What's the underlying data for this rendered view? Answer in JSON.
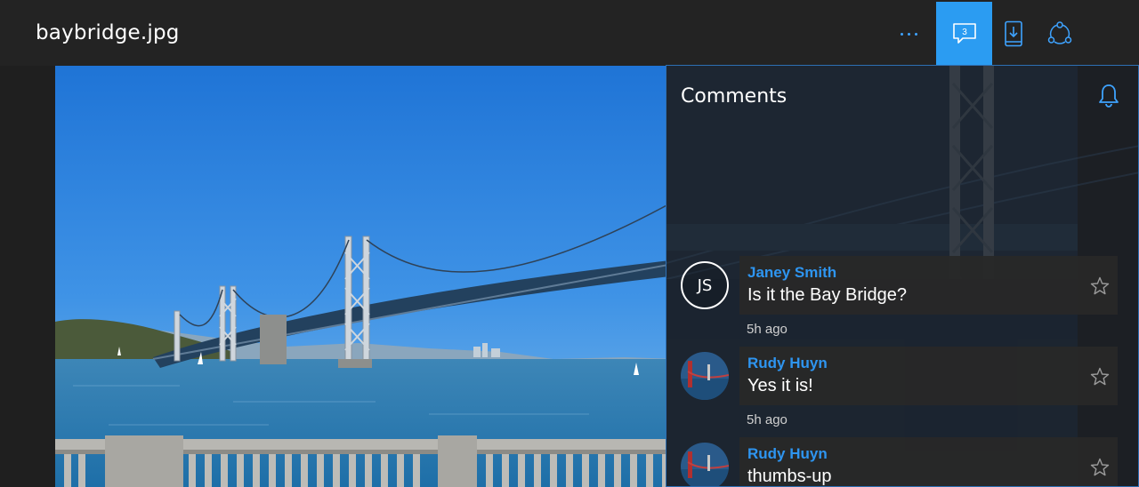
{
  "titlebar": {
    "title": "baybridge.jpg",
    "more_icon": "more-dots-icon",
    "comments_icon": "comment-icon",
    "comments_count": "3",
    "download_icon": "phone-download-icon",
    "share_icon": "share-icon",
    "accent_color": "#2b9cf2"
  },
  "photo": {
    "subject": "bridge-photo"
  },
  "comments_pane": {
    "title": "Comments",
    "bell_icon": "bell-icon",
    "comments": [
      {
        "author": "Janey Smith",
        "initials": "JS",
        "text": "Is it the Bay Bridge?",
        "time": "5h ago"
      },
      {
        "author": "Rudy Huyn",
        "text": "Yes it is!",
        "time": "5h ago"
      },
      {
        "author": "Rudy Huyn",
        "text": "thumbs-up"
      }
    ]
  },
  "colors": {
    "author": "#2e95f0",
    "background": "#1f1f1f",
    "pane_border": "#2d6fb3"
  }
}
